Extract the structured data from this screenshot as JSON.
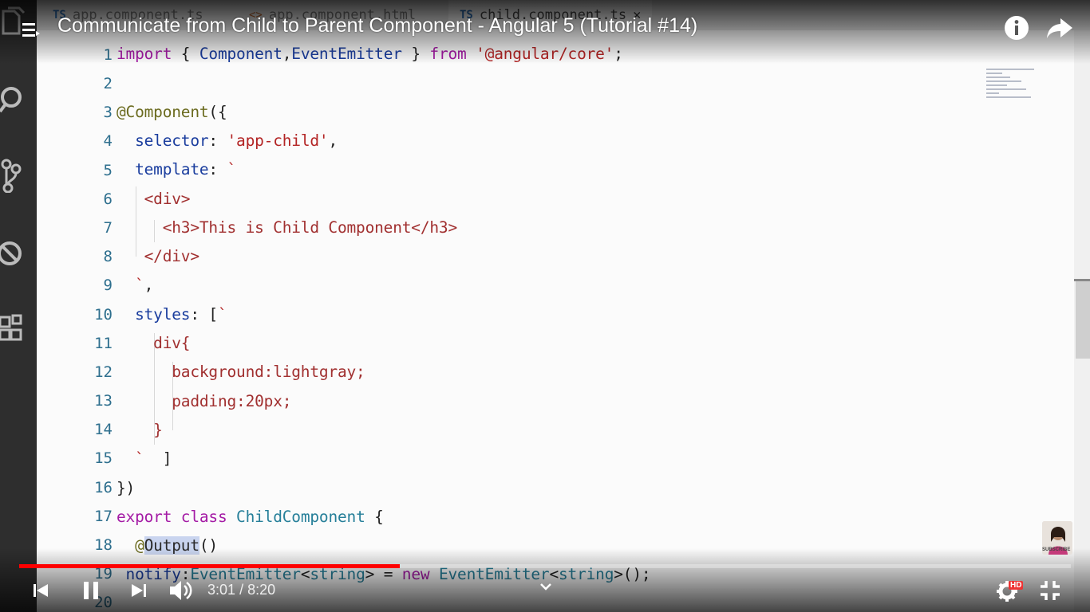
{
  "video": {
    "title": "Communicate from Child to Parent Component - Angular 5 (Tutorial #14)",
    "current_time": "3:01",
    "separator": "/",
    "duration": "8:20",
    "progress_fraction": 0.362,
    "hd_badge": "HD",
    "subscribe_label": "SUBSCRIBE"
  },
  "editor": {
    "tabs": [
      {
        "type_badge": "TS",
        "label": "app.component.ts"
      },
      {
        "type_badge": "<>",
        "label": "app.component.html"
      },
      {
        "type_badge": "TS",
        "label": "child.component.ts",
        "close": "✕"
      }
    ],
    "line_numbers": [
      "1",
      "2",
      "3",
      "4",
      "5",
      "6",
      "7",
      "8",
      "9",
      "10",
      "11",
      "12",
      "13",
      "14",
      "15",
      "16",
      "17",
      "18",
      "19",
      "20"
    ]
  },
  "icons": {
    "explorer": "files-icon",
    "search": "search-icon",
    "scm": "source-control-icon",
    "debug": "debug-icon",
    "extensions": "extensions-icon"
  },
  "colors": {
    "progress_played": "#ff0000",
    "keyword": "#a41ba5",
    "string": "#b32424"
  }
}
